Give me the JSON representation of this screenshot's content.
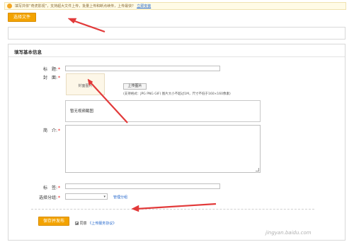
{
  "notice": {
    "text": "填写并依“奇虎影视”，支持超大文件上传，批量上传和断点续传，上传最快？",
    "link": "立即安装"
  },
  "toolbar": {
    "select_file_label": "选择文件"
  },
  "form": {
    "section_title": "填写基本信息",
    "title_label": "标　题:",
    "cover_label": "封　面:",
    "cover_placeholder": "封面图片",
    "upload_label": "上传图片",
    "upload_hint": "(支持格式：JPG PNG GIF) 图片大小不超过1M，尺寸不低于160×160像素)",
    "video_cover_label": "暂无视频截图",
    "intro_label": "简　介:",
    "tags_label": "标　签:",
    "category_label": "选择分组:",
    "category_value": "",
    "manage_link": "管理分组",
    "required_mark": "*"
  },
  "footer": {
    "publish_label": "保存并发布",
    "agree_label": "同意",
    "agree_link": "《上传服务协议》"
  },
  "watermark": "jingyan.baidu.com",
  "colors": {
    "accent": "#f3a300",
    "annotation_arrow": "#e23a3a",
    "link": "#2266cc"
  },
  "icons": {
    "notice": "lightbulb-icon",
    "select": "chevron-down-icon",
    "checkbox": "checkbox-checked-icon"
  }
}
